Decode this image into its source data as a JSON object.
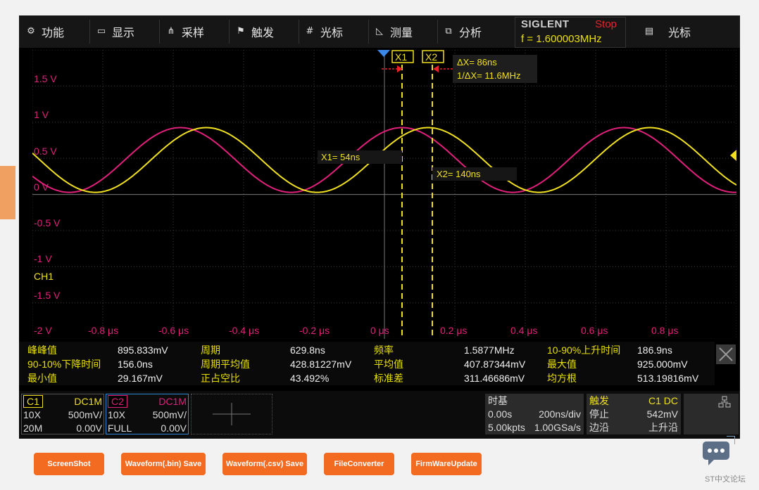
{
  "menu": [
    {
      "label": "功能",
      "icon": "gear-icon"
    },
    {
      "label": "显示",
      "icon": "monitor-icon"
    },
    {
      "label": "采样",
      "icon": "sample-icon"
    },
    {
      "label": "触发",
      "icon": "flag-icon"
    },
    {
      "label": "光标",
      "icon": "cursor-icon"
    },
    {
      "label": "测量",
      "icon": "measure-icon"
    },
    {
      "label": "分析",
      "icon": "analyze-icon"
    }
  ],
  "brand": "SIGLENT",
  "run_state": "Stop",
  "frequency": "f = 1.600003MHz",
  "right_menu": {
    "label": "光标",
    "icon": "clipboard-icon"
  },
  "cursor": {
    "x1_label": "X1",
    "x2_label": "X2",
    "delta_x": "ΔX= 86ns",
    "inv_delta_x": "1/ΔX= 11.6MHz",
    "x1_value": "X1= 54ns",
    "x2_value": "X2= 140ns"
  },
  "voltage_labels": [
    "1.5 V",
    "1 V",
    "0.5 V",
    "0 V",
    "-0.5 V",
    "-1 V",
    "-1.5 V",
    "-2 V"
  ],
  "time_labels": [
    "-0.8 μs",
    "-0.6 μs",
    "-0.4 μs",
    "-0.2 μs",
    "0 μs",
    "0.2 μs",
    "0.4 μs",
    "0.6 μs",
    "0.8 μs"
  ],
  "channel_tag": "CH1",
  "measurements": [
    [
      {
        "label": "峰峰值",
        "value": "895.833mV"
      },
      {
        "label": "周期",
        "value": "629.8ns"
      },
      {
        "label": "频率",
        "value": "1.5877MHz"
      },
      {
        "label": "10-90%上升时间",
        "value": "186.9ns"
      }
    ],
    [
      {
        "label": "90-10%下降时间",
        "value": "156.0ns"
      },
      {
        "label": "周期平均值",
        "value": "428.81227mV"
      },
      {
        "label": "平均值",
        "value": "407.87344mV"
      },
      {
        "label": "最大值",
        "value": "925.000mV"
      }
    ],
    [
      {
        "label": "最小值",
        "value": "29.167mV"
      },
      {
        "label": "正占空比",
        "value": "43.492%"
      },
      {
        "label": "标准差",
        "value": "311.46686mV"
      },
      {
        "label": "均方根",
        "value": "513.19816mV"
      }
    ]
  ],
  "ch1": {
    "name": "C1",
    "coupling": "DC1M",
    "probe": "10X",
    "scale": "500mV/",
    "bw": "20M",
    "offset": "0.00V"
  },
  "ch2": {
    "name": "C2",
    "coupling": "DC1M",
    "probe": "10X",
    "scale": "500mV/",
    "bw": "FULL",
    "offset": "0.00V"
  },
  "timebase": {
    "title": "时基",
    "delay": "0.00s",
    "scale": "200ns/div",
    "points": "5.00kpts",
    "rate": "1.00GSa/s"
  },
  "trigger": {
    "title": "触发",
    "source": "C1 DC",
    "mode": "停止",
    "level": "542mV",
    "type": "边沿",
    "slope": "上升沿"
  },
  "buttons": [
    "ScreenShot",
    "Waveform(.bin) Save",
    "Waveform(.csv) Save",
    "FileConverter",
    "FirmWareUpdate"
  ],
  "watermark": "ST中文论坛",
  "colors": {
    "ch1": "#f0e020",
    "ch2": "#e0207a",
    "accent": "#f36a21",
    "stop": "#e8232a"
  }
}
